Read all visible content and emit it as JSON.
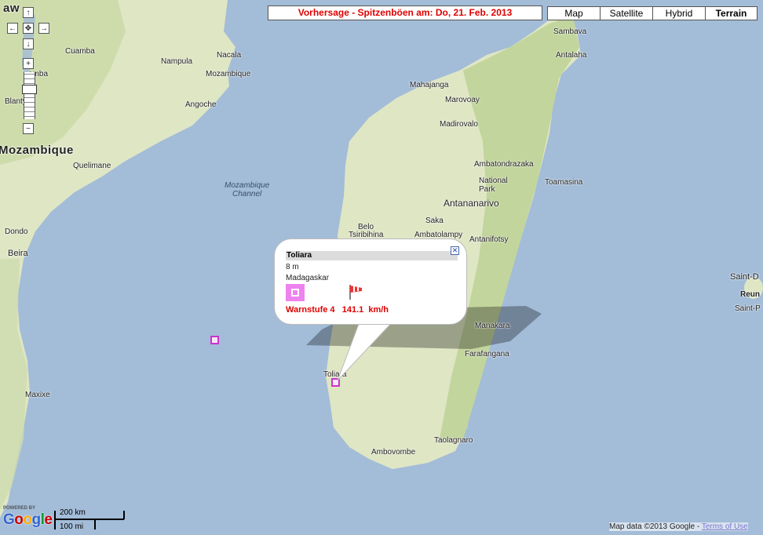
{
  "header": {
    "forecast_title": "Vorhersage - Spitzenböen am: Do, 21. Feb. 2013"
  },
  "map_types": [
    {
      "label": "Map",
      "active": false
    },
    {
      "label": "Satellite",
      "active": false
    },
    {
      "label": "Hybrid",
      "active": false
    },
    {
      "label": "Terrain",
      "active": true
    }
  ],
  "nav": {
    "up_icon": "arrow-up-icon",
    "left_icon": "arrow-left-icon",
    "right_icon": "arrow-right-icon",
    "down_icon": "arrow-down-icon",
    "center_icon": "pan-center-icon",
    "zoom_in": "+",
    "zoom_out": "−"
  },
  "places": {
    "countries": {
      "mozambique": "Mozambique",
      "malawi_partial": "aw"
    },
    "seas": {
      "channel_line1": "Mozambique",
      "channel_line2": "Channel"
    },
    "cities": {
      "cuamba": "Cuamba",
      "nampula": "Nampula",
      "nacala": "Nacala",
      "mozambique_town": "Mozambique",
      "zomba_partial": "omba",
      "blantyre_partial": "Blantyre",
      "angoche": "Angoche",
      "quelimane": "Quelimane",
      "dondo": "Dondo",
      "beira": "Beira",
      "maxixe": "Maxixe",
      "sambava": "Sambava",
      "antalaha": "Antalaha",
      "mahajanga": "Mahajanga",
      "marovoay": "Marovoay",
      "madirovalo": "Madirovalo",
      "ambatondrazaka": "Ambatondrazaka",
      "national_park_l1": "National",
      "national_park_l2": "Park",
      "toamasina": "Toamasina",
      "antananarivo": "Antananarivo",
      "sakay": "Saka",
      "belo": "Belo",
      "tsiribihina": "Tsiribihina",
      "ambatolampy": "Ambatolampy",
      "antanifotsy": "Antanifotsy",
      "manakara": "Manakara",
      "farafangana": "Farafangana",
      "toliara": "Toliara",
      "ambovombe": "Ambovombe",
      "taolagnaro": "Taolagnaro",
      "saint_denis": "Saint-D",
      "reunion": "Reun",
      "saint_pierre": "Saint-P"
    }
  },
  "popup": {
    "title": "Toliara",
    "elevation": "8 m",
    "country": "Madagaskar",
    "warning": "Warnstufe 4   141.1  km/h",
    "close_icon": "close-icon",
    "windsock_icon": "windsock-icon"
  },
  "markers": [
    {
      "name": "toliara-marker"
    },
    {
      "name": "channel-marker"
    }
  ],
  "footer": {
    "powered_by": "POWERED BY",
    "google_logo": "Google",
    "scale_km": "200 km",
    "scale_mi": "100 mi",
    "copyright": "Map data ©2013 Google - ",
    "terms": "Terms of Use"
  },
  "colors": {
    "water": "#a3bcd8",
    "land": "#e6e4cf",
    "forest": "#c7d8a8",
    "warning_red": "#e00000",
    "marker_magenta": "#cc33cc"
  }
}
